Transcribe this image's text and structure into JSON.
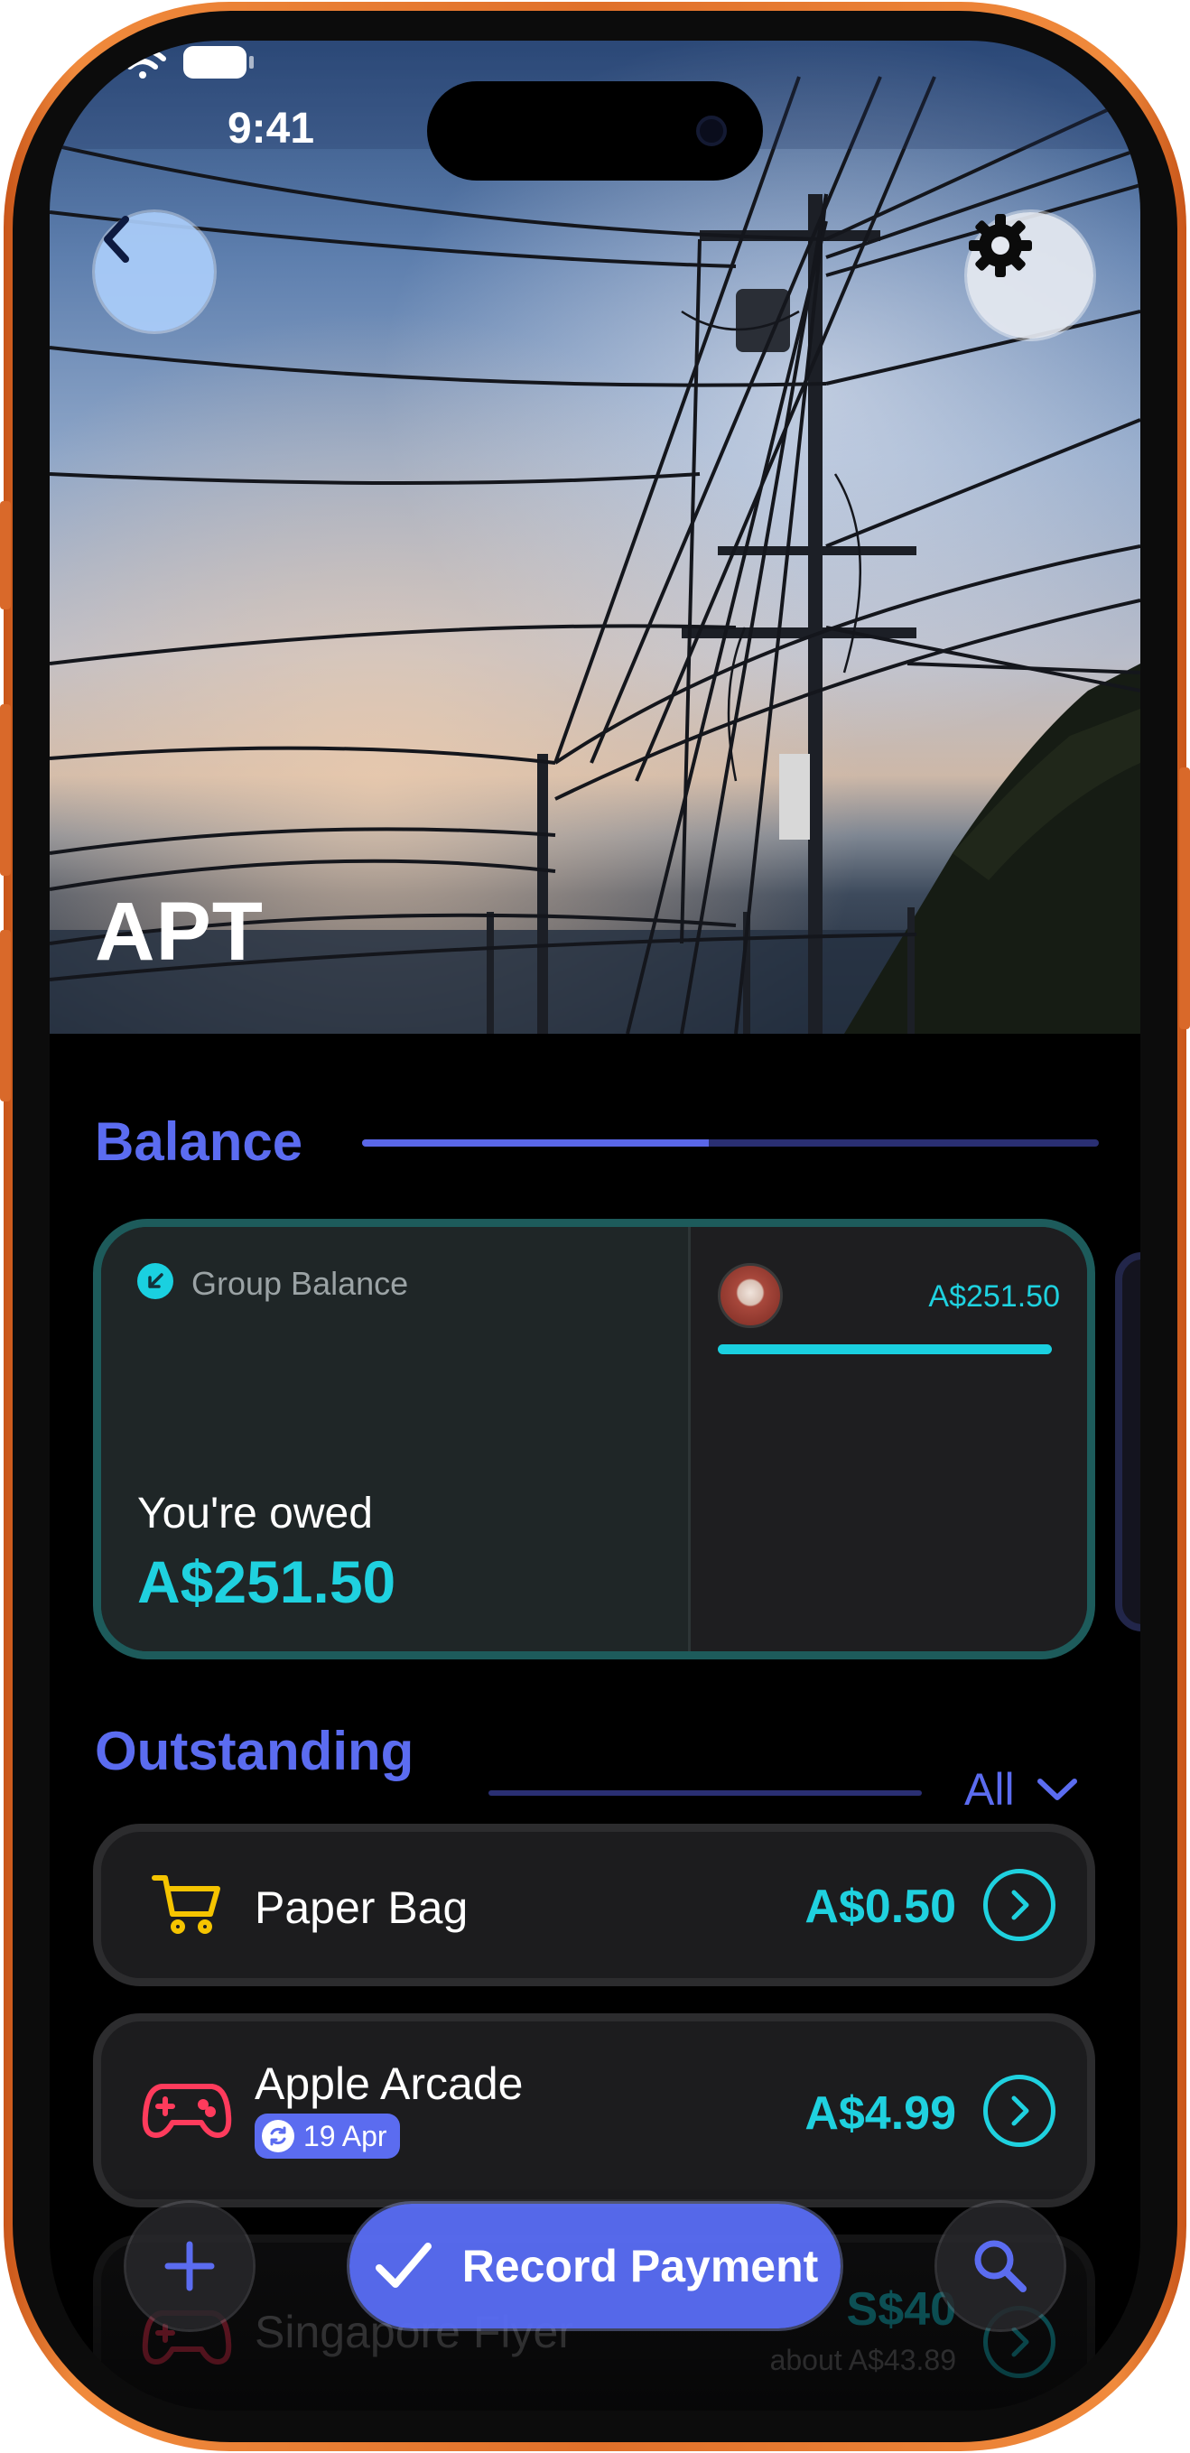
{
  "status_bar": {
    "time": "9:41"
  },
  "header": {
    "group_name": "APT"
  },
  "balance": {
    "section_title": "Balance",
    "card_label": "Group Balance",
    "summary_label": "You're owed",
    "summary_amount": "A$251.50",
    "member_amount": "A$251.50",
    "progress_fraction": 0.47
  },
  "outstanding": {
    "section_title": "Outstanding",
    "filter_label": "All",
    "items": [
      {
        "name": "Paper Bag",
        "amount": "A$0.50",
        "icon": "shopping-cart-icon",
        "color": "#f5c400"
      },
      {
        "name": "Apple Arcade",
        "amount": "A$4.99",
        "icon": "game-controller-icon",
        "badge": "19 Apr",
        "color": "#ff3b5c"
      },
      {
        "name": "Singapore Flyer",
        "amount": "S$40",
        "subtitle": "about A$43.89",
        "icon": "game-controller-icon",
        "color": "#ff3b5c"
      }
    ]
  },
  "actions": {
    "record_payment": "Record Payment"
  },
  "colors": {
    "accent": "#5b6cf0",
    "teal": "#1fd1df",
    "frame": "#e0702a"
  }
}
